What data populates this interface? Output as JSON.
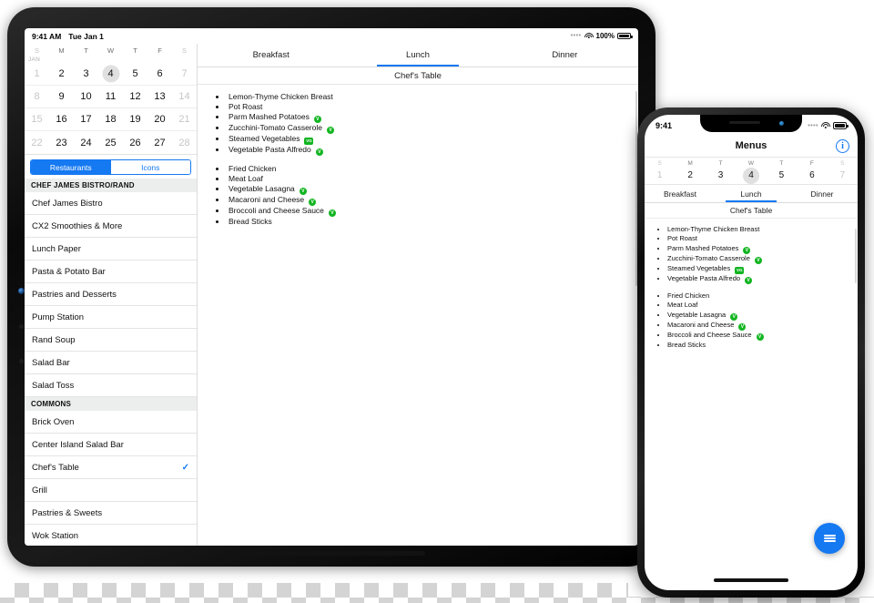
{
  "tablet": {
    "status_bar": {
      "time": "9:41 AM",
      "date": "Tue Jan 1",
      "battery_percent": "100%",
      "wifi_icon": "wifi-icon",
      "battery_icon": "battery-icon"
    },
    "calendar": {
      "month_label": "JAN",
      "day_initials": [
        "S",
        "M",
        "T",
        "W",
        "T",
        "F",
        "S"
      ],
      "weeks": [
        [
          "1",
          "2",
          "3",
          "4",
          "5",
          "6",
          "7"
        ],
        [
          "8",
          "9",
          "10",
          "11",
          "12",
          "13",
          "14"
        ],
        [
          "15",
          "16",
          "17",
          "18",
          "19",
          "20",
          "21"
        ],
        [
          "22",
          "23",
          "24",
          "25",
          "26",
          "27",
          "28"
        ]
      ],
      "selected_day": "4"
    },
    "segmented_control": {
      "options": [
        "Restaurants",
        "Icons"
      ],
      "selected": "Restaurants"
    },
    "restaurant_list": [
      {
        "type": "header",
        "label": "CHEF JAMES BISTRO/RAND"
      },
      {
        "type": "item",
        "label": "Chef James Bistro",
        "checked": false
      },
      {
        "type": "item",
        "label": "CX2 Smoothies & More",
        "checked": false
      },
      {
        "type": "item",
        "label": "Lunch Paper",
        "checked": false
      },
      {
        "type": "item",
        "label": "Pasta & Potato Bar",
        "checked": false
      },
      {
        "type": "item",
        "label": "Pastries and Desserts",
        "checked": false
      },
      {
        "type": "item",
        "label": "Pump Station",
        "checked": false
      },
      {
        "type": "item",
        "label": "Rand Soup",
        "checked": false
      },
      {
        "type": "item",
        "label": "Salad Bar",
        "checked": false
      },
      {
        "type": "item",
        "label": "Salad Toss",
        "checked": false
      },
      {
        "type": "header",
        "label": "COMMONS"
      },
      {
        "type": "item",
        "label": "Brick Oven",
        "checked": false
      },
      {
        "type": "item",
        "label": "Center Island Salad Bar",
        "checked": false
      },
      {
        "type": "item",
        "label": "Chef's Table",
        "checked": true
      },
      {
        "type": "item",
        "label": "Grill",
        "checked": false
      },
      {
        "type": "item",
        "label": "Pastries & Sweets",
        "checked": false
      },
      {
        "type": "item",
        "label": "Wok Station",
        "checked": false
      }
    ],
    "checkmark_glyph": "✓",
    "meal_tabs": [
      "Breakfast",
      "Lunch",
      "Dinner"
    ],
    "selected_meal_tab": "Lunch",
    "venue_title": "Chef's Table",
    "menu_groups": [
      {
        "items": [
          {
            "name": "Lemon-Thyme Chicken Breast",
            "badge": ""
          },
          {
            "name": "Pot Roast",
            "badge": ""
          },
          {
            "name": "Parm Mashed Potatoes",
            "badge": "V"
          },
          {
            "name": "Zucchini-Tomato Casserole",
            "badge": "V"
          },
          {
            "name": "Steamed Vegetables",
            "badge": "VG"
          },
          {
            "name": "Vegetable Pasta Alfredo",
            "badge": "V"
          }
        ]
      },
      {
        "items": [
          {
            "name": "Fried Chicken",
            "badge": ""
          },
          {
            "name": "Meat Loaf",
            "badge": ""
          },
          {
            "name": "Vegetable Lasagna",
            "badge": "V"
          },
          {
            "name": "Macaroni and Cheese",
            "badge": "V"
          },
          {
            "name": "Broccoli and Cheese Sauce",
            "badge": "V"
          },
          {
            "name": "Bread Sticks",
            "badge": ""
          }
        ]
      }
    ]
  },
  "phone": {
    "status_bar": {
      "time": "9:41",
      "wifi_icon": "wifi-icon",
      "battery_icon": "battery-icon"
    },
    "nav_title": "Menus",
    "info_glyph": "i",
    "calendar": {
      "day_initials": [
        "S",
        "M",
        "T",
        "W",
        "T",
        "F",
        "S"
      ],
      "days": [
        "1",
        "2",
        "3",
        "4",
        "5",
        "6",
        "7"
      ],
      "selected_day": "4"
    },
    "meal_tabs": [
      "Breakfast",
      "Lunch",
      "Dinner"
    ],
    "selected_meal_tab": "Lunch",
    "venue_title": "Chef's Table",
    "menu_groups": [
      {
        "items": [
          {
            "name": "Lemon-Thyme Chicken Breast",
            "badge": ""
          },
          {
            "name": "Pot Roast",
            "badge": ""
          },
          {
            "name": "Parm Mashed Potatoes",
            "badge": "V"
          },
          {
            "name": "Zucchini-Tomato Casserole",
            "badge": "V"
          },
          {
            "name": "Steamed Vegetables",
            "badge": "VG"
          },
          {
            "name": "Vegetable Pasta Alfredo",
            "badge": "V"
          }
        ]
      },
      {
        "items": [
          {
            "name": "Fried Chicken",
            "badge": ""
          },
          {
            "name": "Meat Loaf",
            "badge": ""
          },
          {
            "name": "Vegetable Lasagna",
            "badge": "V"
          },
          {
            "name": "Macaroni and Cheese",
            "badge": "V"
          },
          {
            "name": "Broccoli and Cheese Sauce",
            "badge": "V"
          },
          {
            "name": "Bread Sticks",
            "badge": ""
          }
        ]
      }
    ],
    "fab_icon": "menu-icon"
  },
  "colors": {
    "accent": "#1579f2",
    "badge_green": "#12b521",
    "selected_day_bg": "#e0e0e0"
  }
}
